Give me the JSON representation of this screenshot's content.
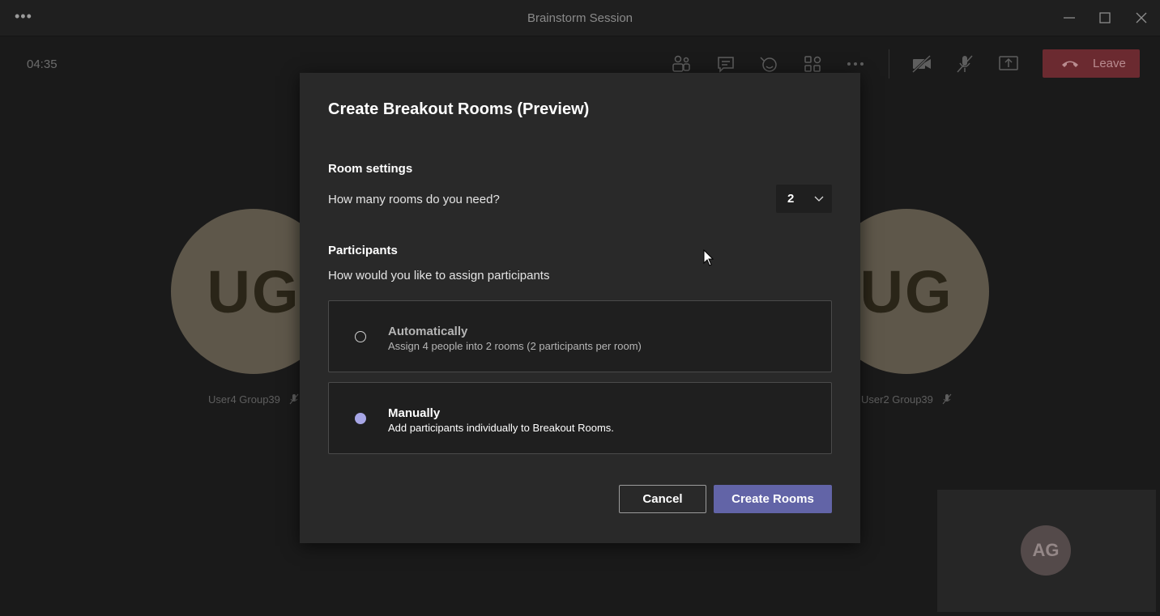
{
  "window": {
    "title": "Brainstorm Session",
    "more_icon": "ellipsis-icon"
  },
  "meeting": {
    "timer": "04:35",
    "leave_label": "Leave",
    "participants": [
      {
        "initials": "UG",
        "name": "User4 Group39"
      },
      {
        "initials": "UG",
        "name": "User2 Group39"
      }
    ],
    "self_initials": "AG"
  },
  "dialog": {
    "title": "Create Breakout Rooms (Preview)",
    "room_settings": {
      "heading": "Room settings",
      "question": "How many rooms do you need?",
      "rooms_value": "2"
    },
    "participants": {
      "heading": "Participants",
      "question": "How would you like to assign participants",
      "options": [
        {
          "title": "Automatically",
          "desc": "Assign 4 people into 2 rooms (2 participants per room)",
          "selected": false
        },
        {
          "title": "Manually",
          "desc": "Add participants individually to Breakout Rooms.",
          "selected": true
        }
      ]
    },
    "buttons": {
      "cancel": "Cancel",
      "create": "Create Rooms"
    }
  },
  "colors": {
    "accent": "#6264a7",
    "radio_selected": "#a7a6e6",
    "leave_dimmed": "#6b2a30"
  }
}
